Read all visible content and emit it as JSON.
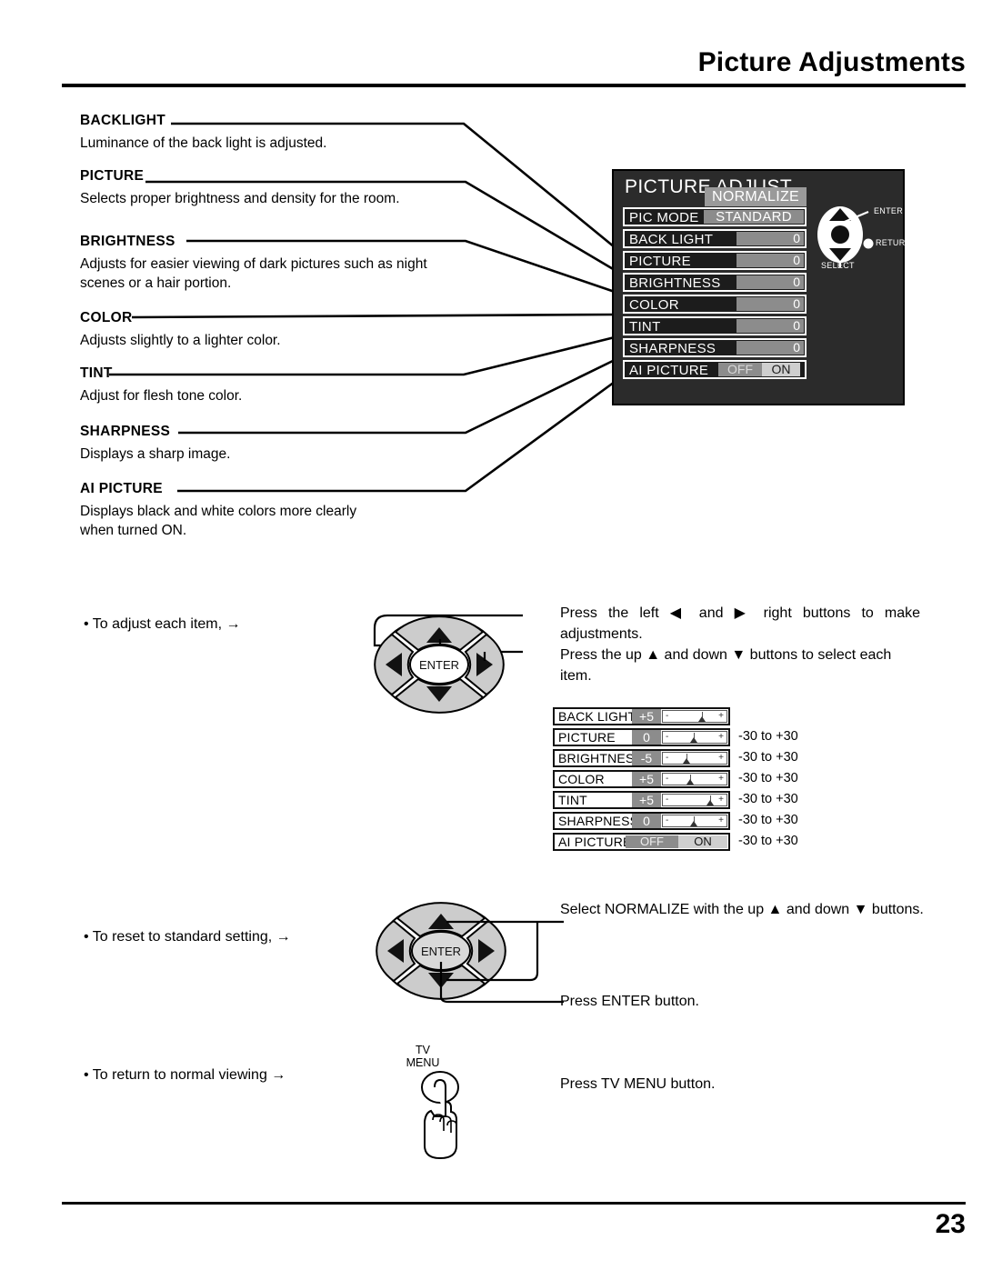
{
  "header": {
    "title": "Picture Adjustments",
    "page_number": "23"
  },
  "descriptions": [
    {
      "heading": "BACKLIGHT",
      "body": "Luminance of the back light is adjusted."
    },
    {
      "heading": "PICTURE",
      "body": "Selects proper brightness and density for the room."
    },
    {
      "heading": "BRIGHTNESS",
      "body": "Adjusts for easier viewing of dark pictures such as night\nscenes or a hair portion."
    },
    {
      "heading": "COLOR",
      "body": "Adjusts slightly to a lighter color."
    },
    {
      "heading": "TINT",
      "body": "Adjust for flesh tone color."
    },
    {
      "heading": "SHARPNESS",
      "body": "Displays a sharp image."
    },
    {
      "heading": "AI PICTURE",
      "body": "Displays black and white colors more clearly\nwhen turned ON."
    }
  ],
  "osd_main": {
    "title": "PICTURE ADJUST",
    "normalize_label": "NORMALIZE",
    "pic_mode": {
      "label": "PIC  MODE",
      "value": "STANDARD"
    },
    "rows": [
      {
        "label": "BACK  LIGHT",
        "value": "0"
      },
      {
        "label": "PICTURE",
        "value": "0"
      },
      {
        "label": "BRIGHTNESS",
        "value": "0"
      },
      {
        "label": "COLOR",
        "value": "0"
      },
      {
        "label": "TINT",
        "value": "0"
      },
      {
        "label": "SHARPNESS",
        "value": "0"
      }
    ],
    "ai_picture": {
      "label": "AI  PICTURE",
      "off": "OFF",
      "on": "ON"
    },
    "nav": {
      "enter": "ENTER",
      "return": "RETURN",
      "select": "SELECT"
    }
  },
  "steps": {
    "adjust": {
      "bullet": "• To adjust each item, →",
      "line1": "Press the left ◀ and ▶ right buttons to make adjustments.",
      "line2": "Press the up ▲ and down ▼ buttons to select each item.",
      "dpad_enter": "ENTER"
    },
    "reset": {
      "bullet": "• To reset to standard setting, →",
      "line1": "Select NORMALIZE with the up ▲ and down ▼ buttons.",
      "line2": "Press ENTER button.",
      "dpad_enter": "ENTER"
    },
    "return": {
      "bullet": "• To return to normal viewing →",
      "button_label_line1": "TV",
      "button_label_line2": "MENU",
      "line1": "Press TV MENU button."
    }
  },
  "osd_values": {
    "rows": [
      {
        "label": "BACK  LIGHT",
        "value": "+5",
        "range": "-30 to +30",
        "pos": 72
      },
      {
        "label": "PICTURE",
        "value": "0",
        "range": "-30 to +30",
        "pos": 50
      },
      {
        "label": "BRIGHTNESS",
        "value": "-5",
        "range": "-30 to +30",
        "pos": 33
      },
      {
        "label": "COLOR",
        "value": "+5",
        "range": "-30 to +30",
        "pos": 40
      },
      {
        "label": "TINT",
        "value": "+5",
        "range": "-30 to +30",
        "pos": 80
      },
      {
        "label": "SHARPNESS",
        "value": "0",
        "range": "-30 to +30",
        "pos": 50
      }
    ],
    "slider_minus": "-",
    "slider_plus": "+",
    "ai_picture": {
      "label": "AI  PICTURE",
      "off": "OFF",
      "on": "ON"
    }
  },
  "colors": {
    "osd_bg": "#2b2b2b",
    "osd_row_bg": "#1c1c1c",
    "value_gray": "#8c8c8c",
    "normalize_gray": "#9a9a9a",
    "on_light": "#cfcfcf",
    "ink": "#000000"
  }
}
